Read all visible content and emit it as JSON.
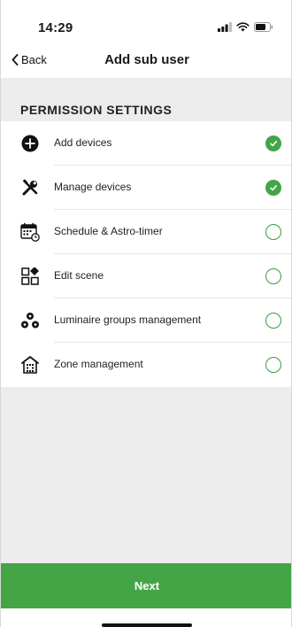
{
  "status_bar": {
    "time": "14:29",
    "icons": [
      "signal-icon",
      "wifi-icon",
      "battery-icon"
    ]
  },
  "nav": {
    "back_label": "Back",
    "title": "Add sub user"
  },
  "section": {
    "title": "PERMISSION SETTINGS"
  },
  "permissions": [
    {
      "label": "Add devices",
      "icon": "add-icon",
      "enabled": true
    },
    {
      "label": "Manage devices",
      "icon": "tools-icon",
      "enabled": true
    },
    {
      "label": "Schedule & Astro-timer",
      "icon": "calendar-clock-icon",
      "enabled": false
    },
    {
      "label": "Edit scene",
      "icon": "scene-grid-icon",
      "enabled": false
    },
    {
      "label": "Luminaire groups management",
      "icon": "luminaire-group-icon",
      "enabled": false
    },
    {
      "label": "Zone management",
      "icon": "zone-building-icon",
      "enabled": false
    }
  ],
  "footer": {
    "next_label": "Next"
  },
  "colors": {
    "accent": "#44a547",
    "background": "#ececec"
  }
}
